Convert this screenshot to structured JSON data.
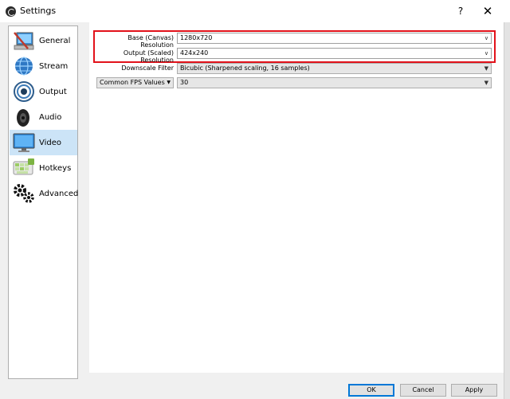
{
  "window": {
    "title": "Settings",
    "help_label": "?",
    "close_label": "✕"
  },
  "sidebar": {
    "items": [
      {
        "label": "General",
        "icon": "general-icon"
      },
      {
        "label": "Stream",
        "icon": "stream-icon"
      },
      {
        "label": "Output",
        "icon": "output-icon"
      },
      {
        "label": "Audio",
        "icon": "audio-icon"
      },
      {
        "label": "Video",
        "icon": "video-icon",
        "selected": true
      },
      {
        "label": "Hotkeys",
        "icon": "hotkeys-icon"
      },
      {
        "label": "Advanced",
        "icon": "advanced-icon"
      }
    ]
  },
  "video": {
    "base_label": "Base (Canvas) Resolution",
    "base_value": "1280x720",
    "output_label": "Output (Scaled) Resolution",
    "output_value": "424x240",
    "filter_label": "Downscale Filter",
    "filter_value": "Bicubic (Sharpened scaling, 16 samples)",
    "fps_mode": "Common FPS Values",
    "fps_value": "30"
  },
  "buttons": {
    "ok": "OK",
    "cancel": "Cancel",
    "apply": "Apply"
  },
  "colors": {
    "highlight": "#e2121a",
    "selected": "#cce4f7"
  }
}
